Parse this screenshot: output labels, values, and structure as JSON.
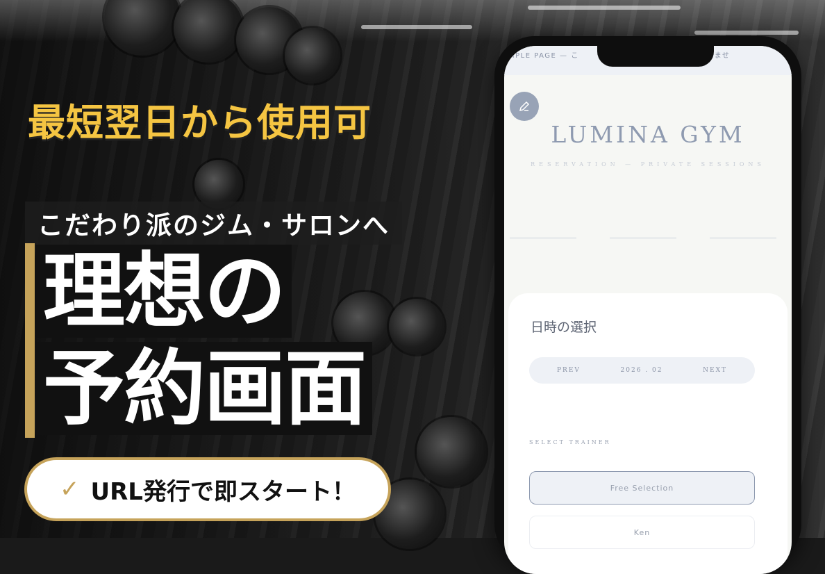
{
  "hero": {
    "headline": "最短翌日から使用可",
    "subheadline": "こだわり派のジム・サロンへ",
    "title_line1": "理想の",
    "title_line2": "予約画面",
    "cta_check": "✓",
    "cta_text": "URL発行で即スタート！"
  },
  "phone": {
    "topbar_text": "MPLE PAGE — こ　　　　　　　　　　の予約は行われませ",
    "edit_icon": "pencil-icon",
    "brand": "LUMINA GYM",
    "tagline": "RESERVATION — PRIVATE SESSIONS",
    "section_title": "日時の選択",
    "calendar": {
      "prev": "PREV",
      "month": "2026 . 02",
      "next": "NEXT"
    },
    "trainer_label": "SELECT TRAINER",
    "trainer_options": [
      "Free Selection",
      "Ken"
    ]
  },
  "colors": {
    "accent_gold": "#c6a35a",
    "headline_yellow": "#f5c542",
    "brand_blue_gray": "#8e9ab0"
  }
}
